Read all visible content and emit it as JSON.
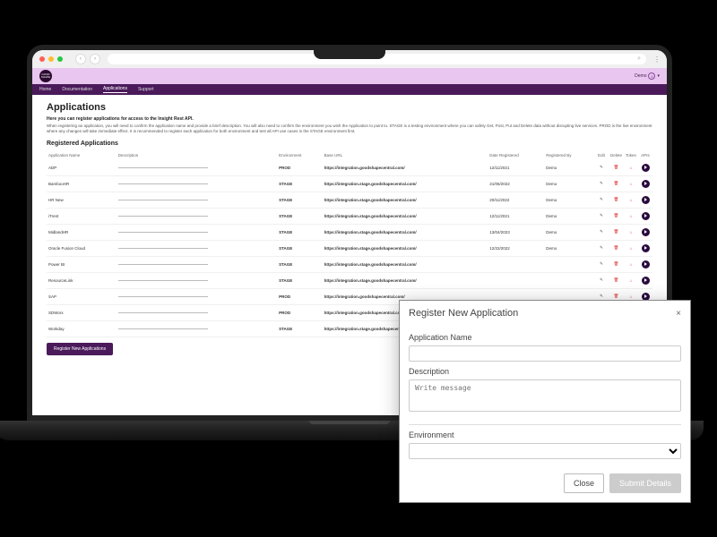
{
  "user_label": "Demo",
  "logo_text": "GOOD SHAPE",
  "nav": {
    "home": "Home",
    "docs": "Documentation",
    "apps": "Applications",
    "support": "Support"
  },
  "page": {
    "title": "Applications",
    "intro_bold": "Here you can register applications for access to the Insight Rest API.",
    "intro": "When registering an application, you will need to confirm the application name and provide a brief description. You will also need to confirm the environment you wish the Application to point to. STAGE is a testing environment where you can safely Get, Post, Put and Delete data without disrupting live services. PROD is the live environment where any changes will take immediate effect. It is recommended to register each application for both environment and test all API use cases in the STAGE environment first.",
    "subtitle": "Registered Applications",
    "register_btn": "Register New Applications"
  },
  "cols": {
    "name": "Application Name",
    "desc": "Description",
    "env": "Environment",
    "url": "Base URL",
    "date": "Date Registered",
    "by": "Registered By",
    "edit": "Edit",
    "del": "Delete",
    "token": "Token",
    "apis": "APIs"
  },
  "rows": [
    {
      "name": "ADP",
      "env": "PROD",
      "url": "https://integration.goodshapecentral.com/",
      "date": "12/11/2021",
      "by": "Demo"
    },
    {
      "name": "BambooHR",
      "env": "STAGE",
      "url": "https://integration.stage.goodshapecentral.com/",
      "date": "21/05/2022",
      "by": "Demo"
    },
    {
      "name": "HR New",
      "env": "STAGE",
      "url": "https://integration.stage.goodshapecentral.com/",
      "date": "20/11/2022",
      "by": "Demo"
    },
    {
      "name": "iTrent",
      "env": "STAGE",
      "url": "https://integration.stage.goodshapecentral.com/",
      "date": "12/11/2021",
      "by": "Demo"
    },
    {
      "name": "MidlandHR",
      "env": "STAGE",
      "url": "https://integration.stage.goodshapecentral.com/",
      "date": "13/04/2023",
      "by": "Demo"
    },
    {
      "name": "Oracle Fusion Cloud",
      "env": "STAGE",
      "url": "https://integration.stage.goodshapecentral.com/",
      "date": "12/22/2022",
      "by": "Demo"
    },
    {
      "name": "Power BI",
      "env": "STAGE",
      "url": "https://integration.stage.goodshapecentral.com/",
      "date": "",
      "by": ""
    },
    {
      "name": "ResourceLink",
      "env": "STAGE",
      "url": "https://integration.stage.goodshapecentral.com/",
      "date": "",
      "by": ""
    },
    {
      "name": "SAP",
      "env": "PROD",
      "url": "https://integration.goodshapecentral.com/",
      "date": "",
      "by": ""
    },
    {
      "name": "SDWorx",
      "env": "PROD",
      "url": "https://integration.goodshapecentral.com/",
      "date": "",
      "by": ""
    },
    {
      "name": "Workday",
      "env": "STAGE",
      "url": "https://integration.stage.goodshapecentral.com/",
      "date": "",
      "by": ""
    }
  ],
  "modal": {
    "title": "Register New Application",
    "app_name_label": "Application Name",
    "desc_label": "Description",
    "desc_placeholder": "Write message",
    "env_label": "Environment",
    "close": "Close",
    "submit": "Submit Details"
  }
}
